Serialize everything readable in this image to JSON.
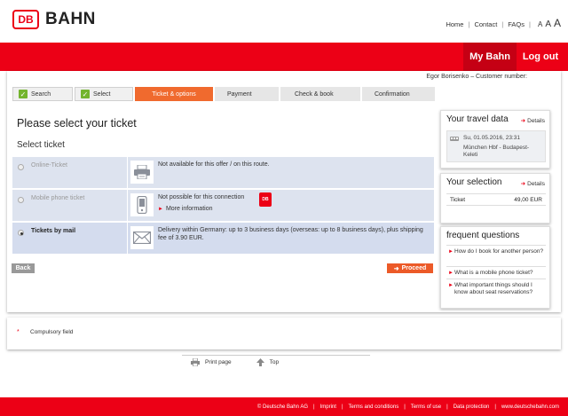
{
  "header": {
    "logo_mark": "DB",
    "logo_text": "BAHN",
    "links": [
      "Home",
      "Contact",
      "FAQs"
    ],
    "font_sizes": [
      "A",
      "A",
      "A"
    ]
  },
  "redbar": {
    "mybahn": "My Bahn",
    "logout": "Log out"
  },
  "customer": "Egor Borisenko – Customer number:",
  "steps": [
    "Search",
    "Select",
    "Ticket & options",
    "Payment",
    "Check & book",
    "Confirmation"
  ],
  "page_title": "Please select your ticket",
  "section_title": "Select ticket",
  "tickets": [
    {
      "name": "Online-Ticket",
      "desc": "Not available for this offer / on this route.",
      "icon": "printer-icon"
    },
    {
      "name": "Mobile phone ticket",
      "desc": "Not possible for this connection",
      "more": "More information",
      "badge": "DB",
      "icon": "phone-icon"
    },
    {
      "name": "Tickets by mail",
      "desc": "Delivery within Germany: up to 3 business days (overseas: up to 8 business days), plus shipping fee of 3.90 EUR.",
      "icon": "envelope-icon",
      "selected": true
    }
  ],
  "buttons": {
    "back": "Back",
    "proceed": "Proceed"
  },
  "travel": {
    "title": "Your travel data",
    "details": "Details",
    "date": "Su, 01.05.2016, 23:31",
    "route": "München Hbf - Budapest-Keleti"
  },
  "selection": {
    "title": "Your selection",
    "details": "Details",
    "item": "Ticket",
    "price": "49,00 EUR"
  },
  "faq": {
    "title": "frequent questions",
    "items": [
      "How do I book for another person?",
      "What is a mobile phone ticket?",
      "What important things should I know about seat reservations?"
    ]
  },
  "compulsory": {
    "star": "*",
    "text": "Compulsory field"
  },
  "tools": {
    "print": "Print page",
    "top": "Top"
  },
  "footer": [
    "© Deutsche Bahn AG",
    "Imprint",
    "Terms and conditions",
    "Terms of use",
    "Data protection",
    "www.deutschebahn.com"
  ],
  "colors": {
    "brand_red": "#ec0016",
    "active_step": "#f06a2e",
    "row_blue": "#d4dcee",
    "check_green": "#73b42d"
  }
}
